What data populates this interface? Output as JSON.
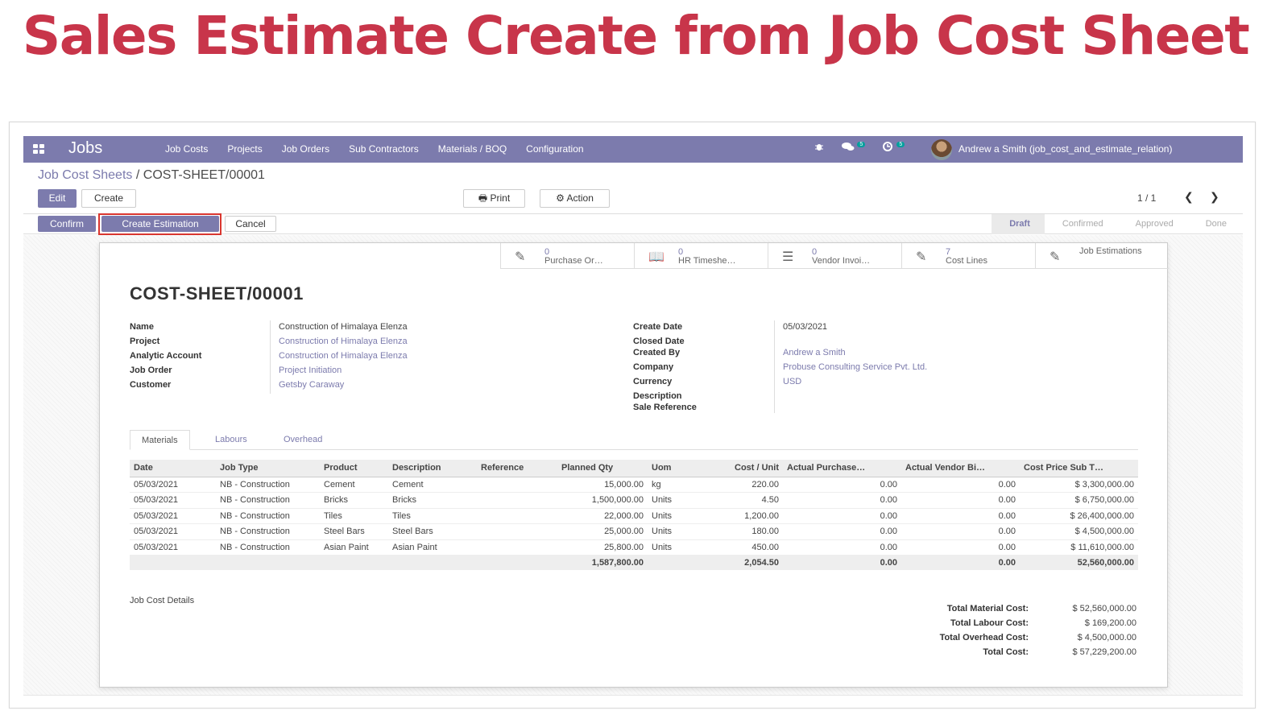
{
  "headline": "Sales Estimate Create from Job Cost Sheet",
  "navbar": {
    "app": "Jobs",
    "menu": [
      "Job Costs",
      "Projects",
      "Job Orders",
      "Sub Contractors",
      "Materials / BOQ",
      "Configuration"
    ],
    "chat_count": "5",
    "activity_count": "5",
    "user": "Andrew a Smith (job_cost_and_estimate_relation)"
  },
  "breadcrumb": {
    "parent": "Job Cost Sheets",
    "separator": "/",
    "current": "COST-SHEET/00001"
  },
  "buttons": {
    "edit": "Edit",
    "create": "Create",
    "print": "Print",
    "action": "Action",
    "confirm": "Confirm",
    "create_estimation": "Create Estimation",
    "cancel": "Cancel"
  },
  "pager": "1 / 1",
  "stages": [
    "Draft",
    "Confirmed",
    "Approved",
    "Done"
  ],
  "active_stage": "Draft",
  "smart_buttons": [
    {
      "count": "0",
      "label": "Purchase Or…",
      "icon": "edit-icon"
    },
    {
      "count": "0",
      "label": "HR Timeshe…",
      "icon": "book-icon"
    },
    {
      "count": "0",
      "label": "Vendor Invoi…",
      "icon": "list-icon"
    },
    {
      "count": "7",
      "label": "Cost Lines",
      "icon": "edit-icon"
    },
    {
      "count": "",
      "label": "Job Estimations",
      "icon": "edit-icon"
    }
  ],
  "record_title": "COST-SHEET/00001",
  "left_fields": {
    "name_label": "Name",
    "name": "Construction of Himalaya Elenza",
    "project_label": "Project",
    "project": "Construction of Himalaya Elenza",
    "analytic_label": "Analytic Account",
    "analytic": "Construction of Himalaya Elenza",
    "job_order_label": "Job Order",
    "job_order": "Project Initiation",
    "customer_label": "Customer",
    "customer": "Getsby Caraway"
  },
  "right_fields": {
    "create_date_label": "Create Date",
    "create_date": "05/03/2021",
    "closed_date_label": "Closed Date",
    "created_by_label": "Created By",
    "created_by": "Andrew a Smith",
    "company_label": "Company",
    "company": "Probuse Consulting Service Pvt. Ltd.",
    "currency_label": "Currency",
    "currency": "USD",
    "description_label": "Description",
    "sale_reference_label": "Sale Reference"
  },
  "tabs": [
    "Materials",
    "Labours",
    "Overhead"
  ],
  "table": {
    "headers": [
      "Date",
      "Job Type",
      "Product",
      "Description",
      "Reference",
      "Planned Qty",
      "Uom",
      "Cost / Unit",
      "Actual Purchase…",
      "Actual Vendor Bi…",
      "Cost Price Sub T…"
    ],
    "rows": [
      [
        "05/03/2021",
        "NB - Construction",
        "Cement",
        "Cement",
        "",
        "15,000.00",
        "kg",
        "220.00",
        "0.00",
        "0.00",
        "$ 3,300,000.00"
      ],
      [
        "05/03/2021",
        "NB - Construction",
        "Bricks",
        "Bricks",
        "",
        "1,500,000.00",
        "Units",
        "4.50",
        "0.00",
        "0.00",
        "$ 6,750,000.00"
      ],
      [
        "05/03/2021",
        "NB - Construction",
        "Tiles",
        "Tiles",
        "",
        "22,000.00",
        "Units",
        "1,200.00",
        "0.00",
        "0.00",
        "$ 26,400,000.00"
      ],
      [
        "05/03/2021",
        "NB - Construction",
        "Steel Bars",
        "Steel Bars",
        "",
        "25,000.00",
        "Units",
        "180.00",
        "0.00",
        "0.00",
        "$ 4,500,000.00"
      ],
      [
        "05/03/2021",
        "NB - Construction",
        "Asian Paint",
        "Asian Paint",
        "",
        "25,800.00",
        "Units",
        "450.00",
        "0.00",
        "0.00",
        "$ 11,610,000.00"
      ]
    ],
    "totals": [
      "",
      "",
      "",
      "",
      "",
      "1,587,800.00",
      "",
      "2,054.50",
      "0.00",
      "0.00",
      "52,560,000.00"
    ]
  },
  "job_cost_details_label": "Job Cost Details",
  "summary": [
    {
      "label": "Total Material Cost:",
      "value": "$ 52,560,000.00"
    },
    {
      "label": "Total Labour Cost:",
      "value": "$ 169,200.00"
    },
    {
      "label": "Total Overhead Cost:",
      "value": "$ 4,500,000.00"
    },
    {
      "label": "Total Cost:",
      "value": "$ 57,229,200.00"
    }
  ],
  "colors": {
    "brand": "#7c7bad",
    "headline": "#c8354a",
    "highlight": "#d9362f"
  }
}
